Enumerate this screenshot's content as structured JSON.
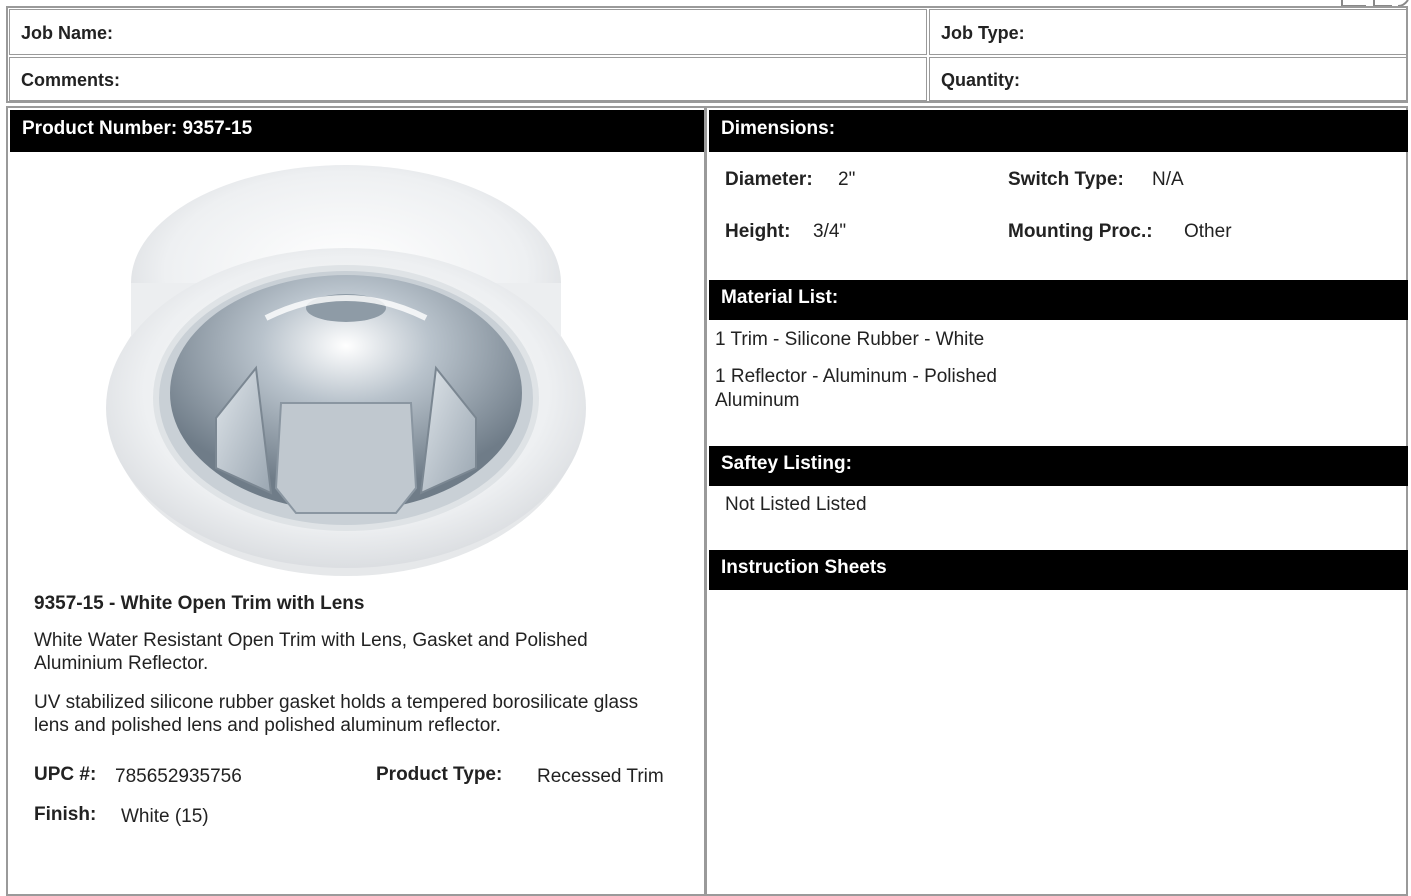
{
  "header": {
    "job_name_label": "Job Name:",
    "job_type_label": "Job Type:",
    "comments_label": "Comments:",
    "quantity_label": "Quantity:"
  },
  "left": {
    "product_number_bar": "Product Number: 9357-15",
    "product_title": "9357-15 - White Open Trim with Lens",
    "description_1": "White Water Resistant Open Trim with Lens, Gasket and Polished Aluminium Reflector.",
    "description_2": "UV stabilized silicone rubber gasket holds a tempered borosilicate glass lens and polished lens and polished aluminum reflector.",
    "upc_label": "UPC #:",
    "upc_value": "785652935756",
    "product_type_label": "Product Type:",
    "product_type_value": "Recessed Trim",
    "finish_label": "Finish:",
    "finish_value": "White (15)"
  },
  "right": {
    "dimensions_bar": "Dimensions:",
    "diameter_label": "Diameter:",
    "diameter_value": "2\"",
    "switch_type_label": "Switch Type:",
    "switch_type_value": "N/A",
    "height_label": "Height:",
    "height_value": "3/4\"",
    "mounting_label": "Mounting Proc.:",
    "mounting_value": "Other",
    "material_bar": "Material List:",
    "material_1": "1 Trim - Silicone Rubber - White",
    "material_2a": "1 Reflector - Aluminum - Polished",
    "material_2b": "Aluminum",
    "safety_bar": "Saftey Listing:",
    "safety_value": "Not Listed Listed",
    "instruction_bar": "Instruction Sheets"
  },
  "colors": {
    "bar_bg": "#000000",
    "border": "#9a9a9a"
  }
}
